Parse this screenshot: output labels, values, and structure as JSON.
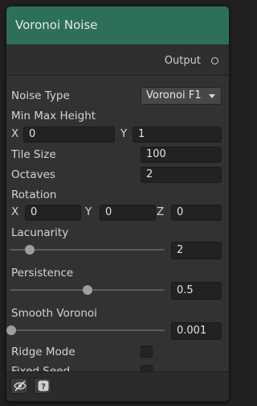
{
  "node": {
    "title": "Voronoi Noise",
    "output_label": "Output",
    "accent_color": "#2d6f5a"
  },
  "fields": {
    "noise_type_label": "Noise Type",
    "noise_type_value": "Voronoi F1",
    "min_max_height_label": "Min Max Height",
    "x_label": "X",
    "y_label": "Y",
    "z_label": "Z",
    "min_value": "0",
    "max_value": "1",
    "tile_size_label": "Tile Size",
    "tile_size_value": "100",
    "octaves_label": "Octaves",
    "octaves_value": "2",
    "rotation_label": "Rotation",
    "rotation_x": "0",
    "rotation_y": "0",
    "rotation_z": "0",
    "lacunarity_label": "Lacunarity",
    "lacunarity_value": "2",
    "lacunarity_slider_fraction": 0.13,
    "persistence_label": "Persistence",
    "persistence_value": "0.5",
    "persistence_slider_fraction": 0.5,
    "smooth_voronoi_label": "Smooth Voronoi",
    "smooth_voronoi_value": "0.001",
    "smooth_voronoi_slider_fraction": 0.0,
    "ridge_mode_label": "Ridge Mode",
    "ridge_mode_checked": false,
    "fixed_seed_label": "Fixed Seed",
    "fixed_seed_checked": false
  },
  "footer": {
    "preview_icon": "eye-slash-icon",
    "help_icon": "question-icon"
  }
}
